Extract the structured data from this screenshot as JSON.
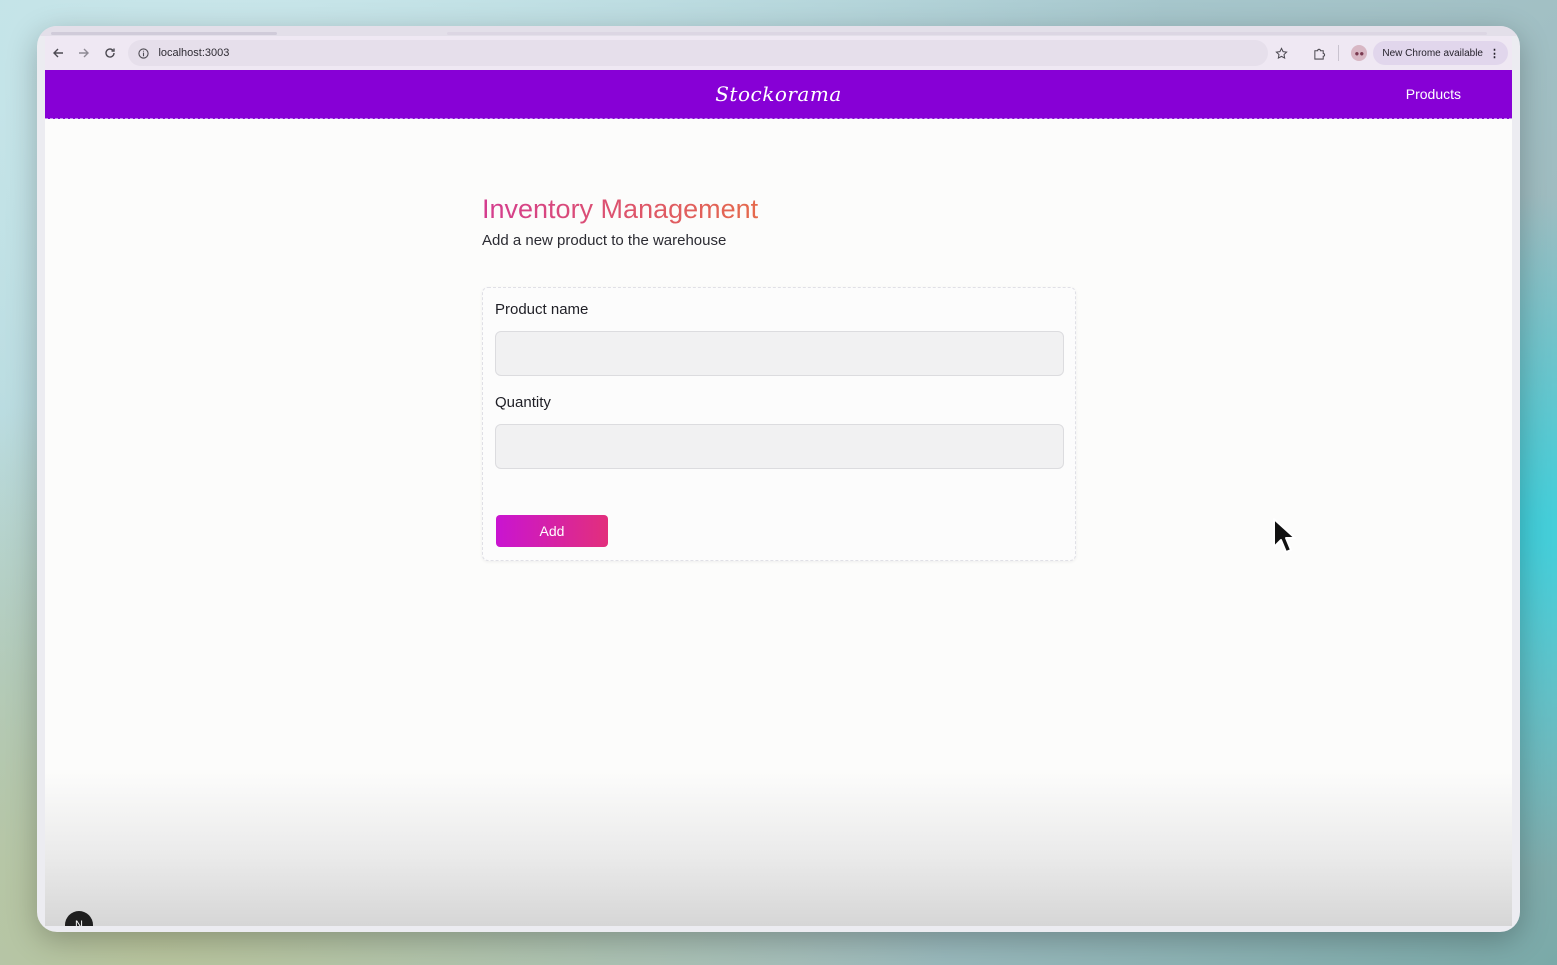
{
  "browser": {
    "url": "localhost:3003",
    "update_pill": "New Chrome available",
    "icons": {
      "back": "arrow-left-icon",
      "forward": "arrow-right-icon",
      "reload": "reload-icon",
      "site_info": "info-icon",
      "bookmark": "star-icon",
      "extensions": "puzzle-icon",
      "profile": "profile-avatar-icon",
      "menu": "kebab-menu-icon"
    }
  },
  "app": {
    "brand": "Stockorama",
    "nav": {
      "products_label": "Products"
    },
    "header_color": "#8700d6"
  },
  "main": {
    "title": "Inventory Management",
    "subtitle": "Add a new product to the warehouse",
    "form": {
      "product_name_label": "Product name",
      "product_name_value": "",
      "quantity_label": "Quantity",
      "quantity_value": "",
      "submit_label": "Add"
    }
  },
  "dev_badge": "N"
}
